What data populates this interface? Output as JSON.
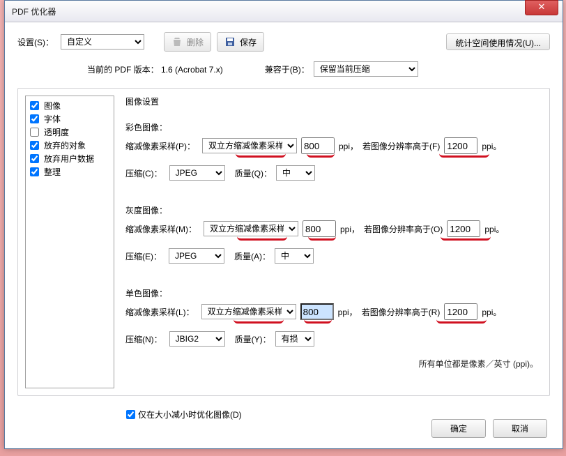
{
  "window": {
    "title": "PDF 优化器",
    "close": "✕"
  },
  "settings": {
    "label": "设置(S)：",
    "value": "自定义",
    "delete": "删除",
    "save": "保存",
    "usage": "统计空间使用情况(U)..."
  },
  "info": {
    "current_version_label": "当前的 PDF 版本：",
    "current_version_value": "1.6 (Acrobat 7.x)",
    "compat_label": "兼容于(B)：",
    "compat_value": "保留当前压缩"
  },
  "sidebar": {
    "items": [
      {
        "label": "图像",
        "checked": true
      },
      {
        "label": "字体",
        "checked": true
      },
      {
        "label": "透明度",
        "checked": false
      },
      {
        "label": "放弃的对象",
        "checked": true
      },
      {
        "label": "放弃用户数据",
        "checked": true
      },
      {
        "label": "整理",
        "checked": true
      }
    ]
  },
  "image_settings": {
    "title": "图像设置",
    "color": {
      "title": "彩色图像：",
      "downsample_label": "缩减像素采样(P)：",
      "downsample_value": "双立方缩减像素采样至",
      "ppi_value": "800",
      "ppi_unit": "ppi，",
      "threshold_label": "若图像分辨率高于(F)",
      "threshold_value": "1200",
      "threshold_unit": "ppi。",
      "compress_label": "压缩(C)：",
      "compress_value": "JPEG",
      "quality_label": "质量(Q)：",
      "quality_value": "中"
    },
    "gray": {
      "title": "灰度图像：",
      "downsample_label": "缩减像素采样(M)：",
      "downsample_value": "双立方缩减像素采样至",
      "ppi_value": "800",
      "ppi_unit": "ppi，",
      "threshold_label": "若图像分辨率高于(O)",
      "threshold_value": "1200",
      "threshold_unit": "ppi。",
      "compress_label": "压缩(E)：",
      "compress_value": "JPEG",
      "quality_label": "质量(A)：",
      "quality_value": "中"
    },
    "mono": {
      "title": "单色图像：",
      "downsample_label": "缩减像素采样(L)：",
      "downsample_value": "双立方缩减像素采样至",
      "ppi_value": "800",
      "ppi_unit": "ppi，",
      "threshold_label": "若图像分辨率高于(R)",
      "threshold_value": "1200",
      "threshold_unit": "ppi。",
      "compress_label": "压缩(N)：",
      "compress_value": "JBIG2",
      "quality_label": "质量(Y)：",
      "quality_value": "有损"
    },
    "units_note": "所有单位都是像素／英寸 (ppi)。",
    "optimize_only_shrink": "仅在大小减小时优化图像(D)"
  },
  "footer": {
    "ok": "确定",
    "cancel": "取消"
  }
}
